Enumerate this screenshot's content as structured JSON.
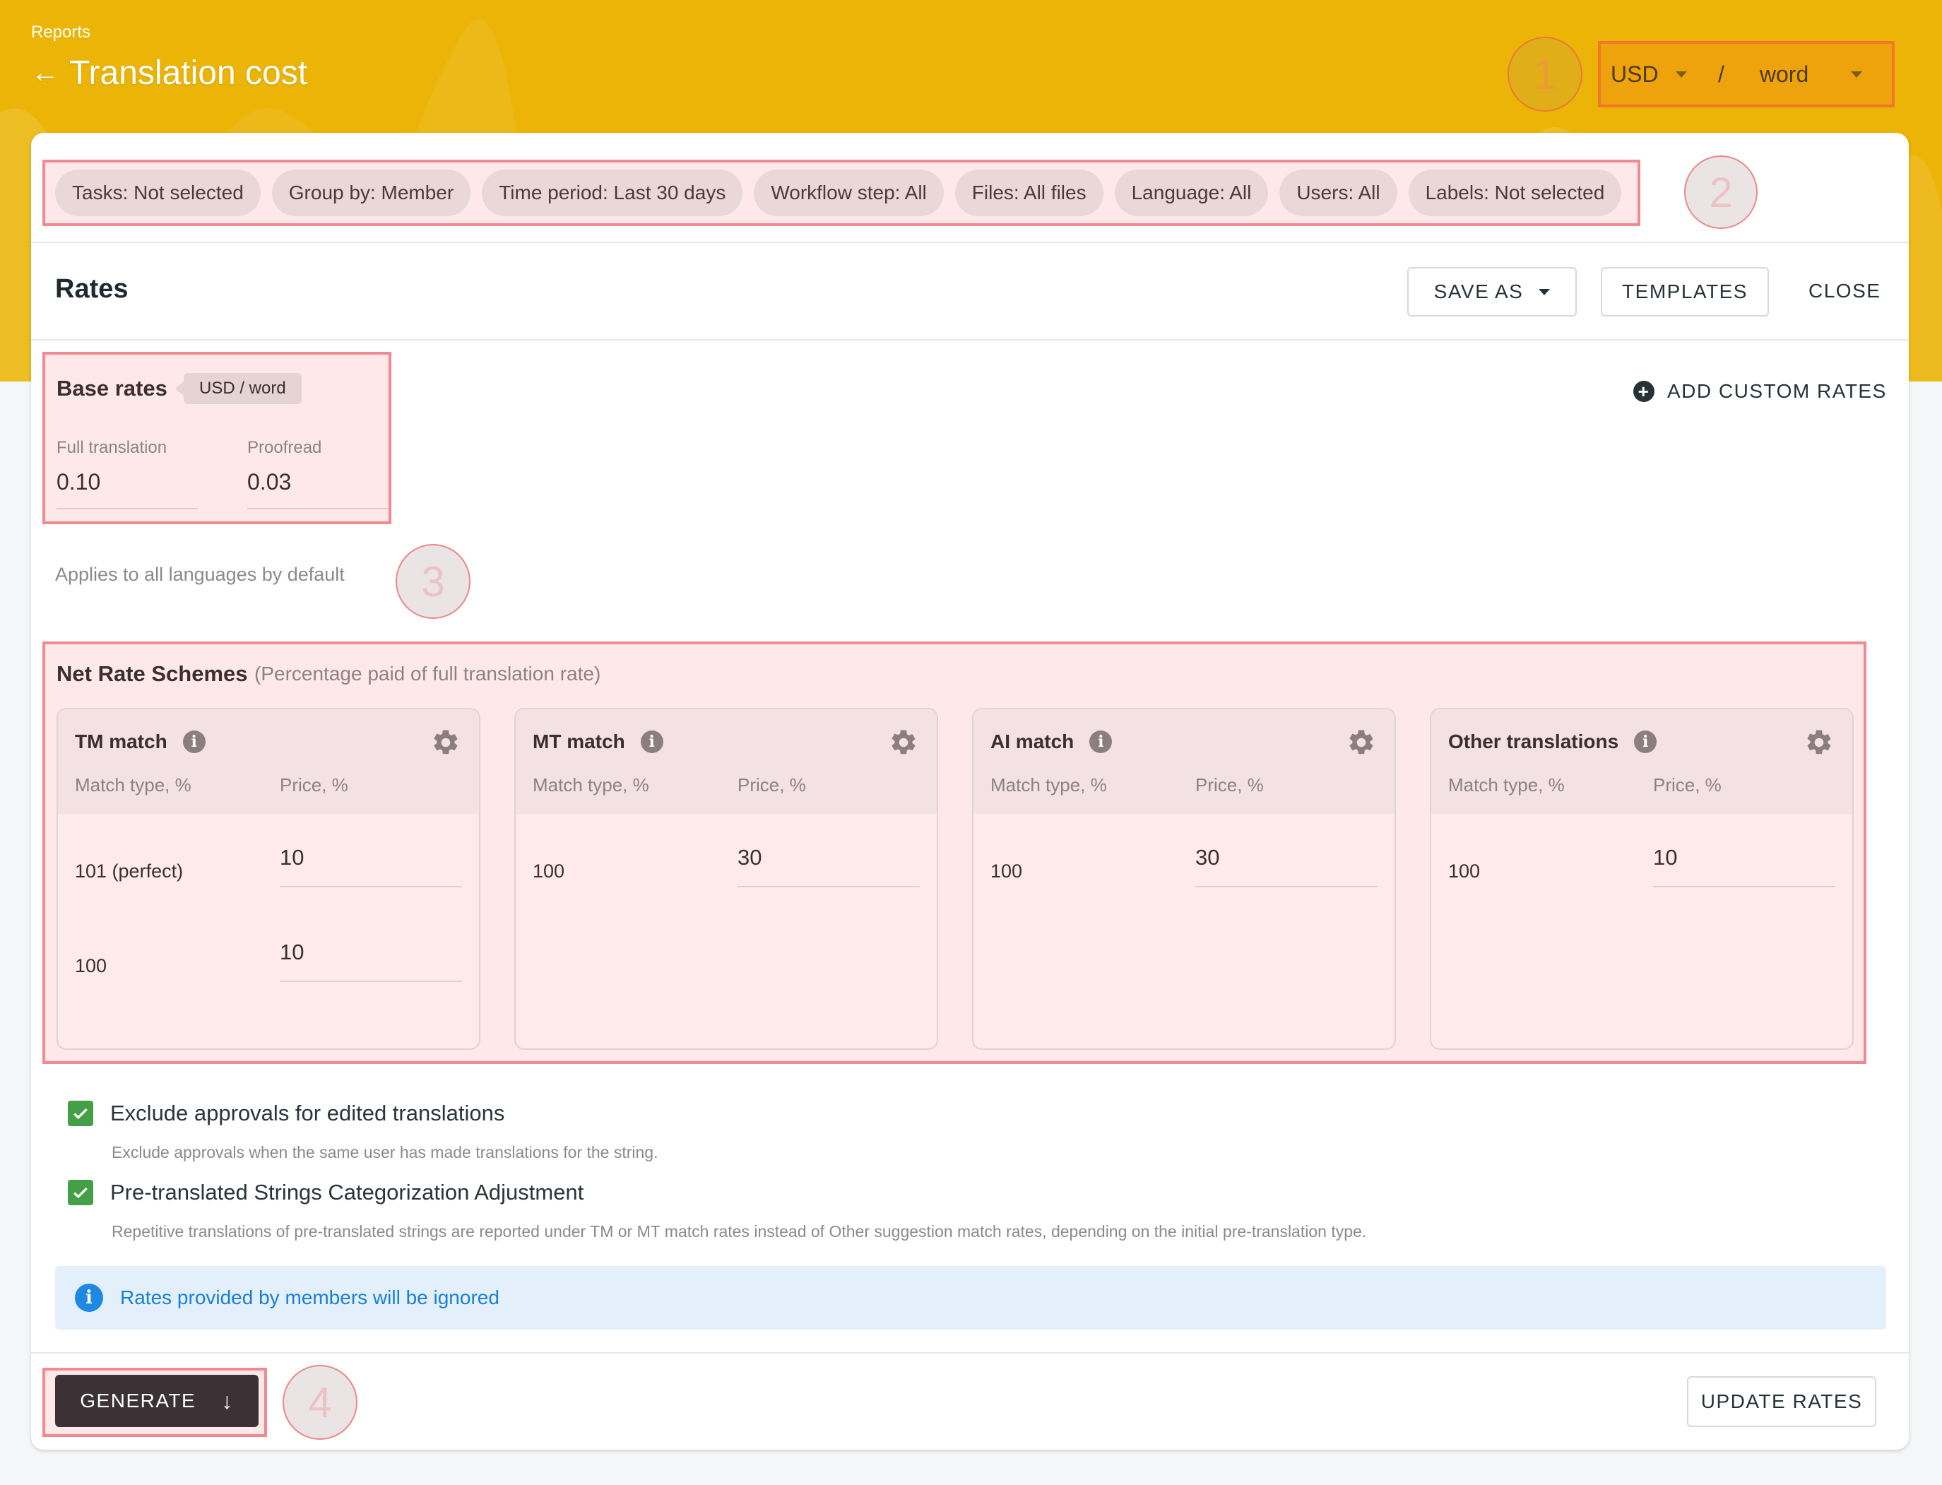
{
  "header": {
    "breadcrumb": "Reports",
    "back_icon": "arrow-left-icon",
    "title": "Translation cost",
    "currency": "USD",
    "separator": "/",
    "unit": "word",
    "annotation_1": "1"
  },
  "filters": {
    "chips": [
      "Tasks: Not selected",
      "Group by: Member",
      "Time period: Last 30 days",
      "Workflow step: All",
      "Files: All files",
      "Language: All",
      "Users: All",
      "Labels: Not selected"
    ],
    "annotation_2": "2"
  },
  "rates": {
    "title": "Rates",
    "save_as": "SAVE AS",
    "templates": "TEMPLATES",
    "close": "CLOSE",
    "add_custom_rates": "ADD CUSTOM RATES",
    "base": {
      "title": "Base rates",
      "unit_tag": "USD / word",
      "full_translation_label": "Full translation",
      "full_translation_value": "0.10",
      "proofread_label": "Proofread",
      "proofread_value": "0.03"
    },
    "applies_note": "Applies to all languages by default",
    "annotation_3": "3"
  },
  "net_rates": {
    "title": "Net Rate Schemes",
    "subtitle": "(Percentage paid of full translation rate)",
    "match_col": "Match type, %",
    "price_col": "Price, %",
    "schemes": [
      {
        "name": "TM match",
        "rows": [
          {
            "match": "101 (perfect)",
            "price": "10"
          },
          {
            "match": "100",
            "price": "10"
          }
        ]
      },
      {
        "name": "MT match",
        "rows": [
          {
            "match": "100",
            "price": "30"
          }
        ]
      },
      {
        "name": "AI match",
        "rows": [
          {
            "match": "100",
            "price": "30"
          }
        ]
      },
      {
        "name": "Other translations",
        "rows": [
          {
            "match": "100",
            "price": "10"
          }
        ]
      }
    ]
  },
  "options": {
    "exclude_label": "Exclude approvals for edited translations",
    "exclude_checked": true,
    "exclude_desc": "Exclude approvals when the same user has made translations for the string.",
    "pretranslated_label": "Pre-translated Strings Categorization Adjustment",
    "pretranslated_checked": true,
    "pretranslated_desc": "Repetitive translations of pre-translated strings are reported under TM or MT match rates instead of Other suggestion match rates, depending on the initial pre-translation type."
  },
  "notice": {
    "text": "Rates provided by members will be ignored"
  },
  "footer": {
    "generate": "GENERATE",
    "update_rates": "UPDATE RATES",
    "annotation_4": "4"
  },
  "colors": {
    "header_bg": "#ebb406",
    "annotation_border": "#f08a8e",
    "checkbox": "#43a047",
    "notice_text": "#1a7fd6",
    "generate_bg": "#3c3235"
  }
}
